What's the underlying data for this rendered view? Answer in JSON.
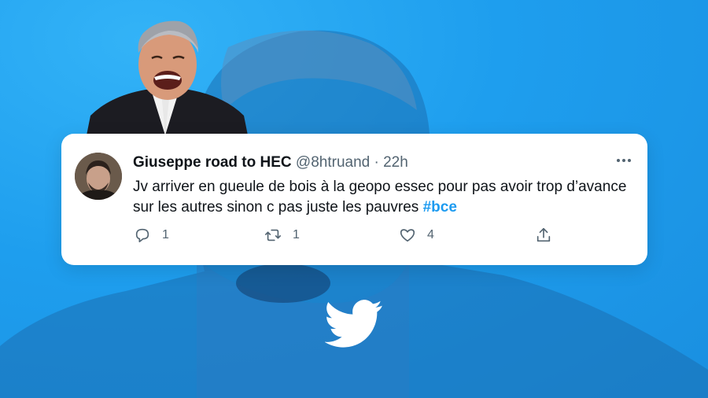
{
  "tweet": {
    "display_name": "Giuseppe road to HEC",
    "handle": "@8htruand",
    "separator": "·",
    "time": "22h",
    "text_before": "Jv arriver en gueule de bois à la geopo essec pour pas avoir trop d’avance sur les autres sinon c pas juste les pauvres ",
    "hashtag": "#bce",
    "replies": "1",
    "retweets": "1",
    "likes": "4"
  },
  "icons": {
    "more": "more-horizontal-icon",
    "reply": "reply-icon",
    "retweet": "retweet-icon",
    "like": "heart-icon",
    "share": "share-icon",
    "brand": "twitter-bird-icon"
  },
  "colors": {
    "background": "#1da1f2",
    "accent": "#1d9bf0",
    "text": "#0f1419",
    "muted": "#536471",
    "card": "#ffffff"
  }
}
